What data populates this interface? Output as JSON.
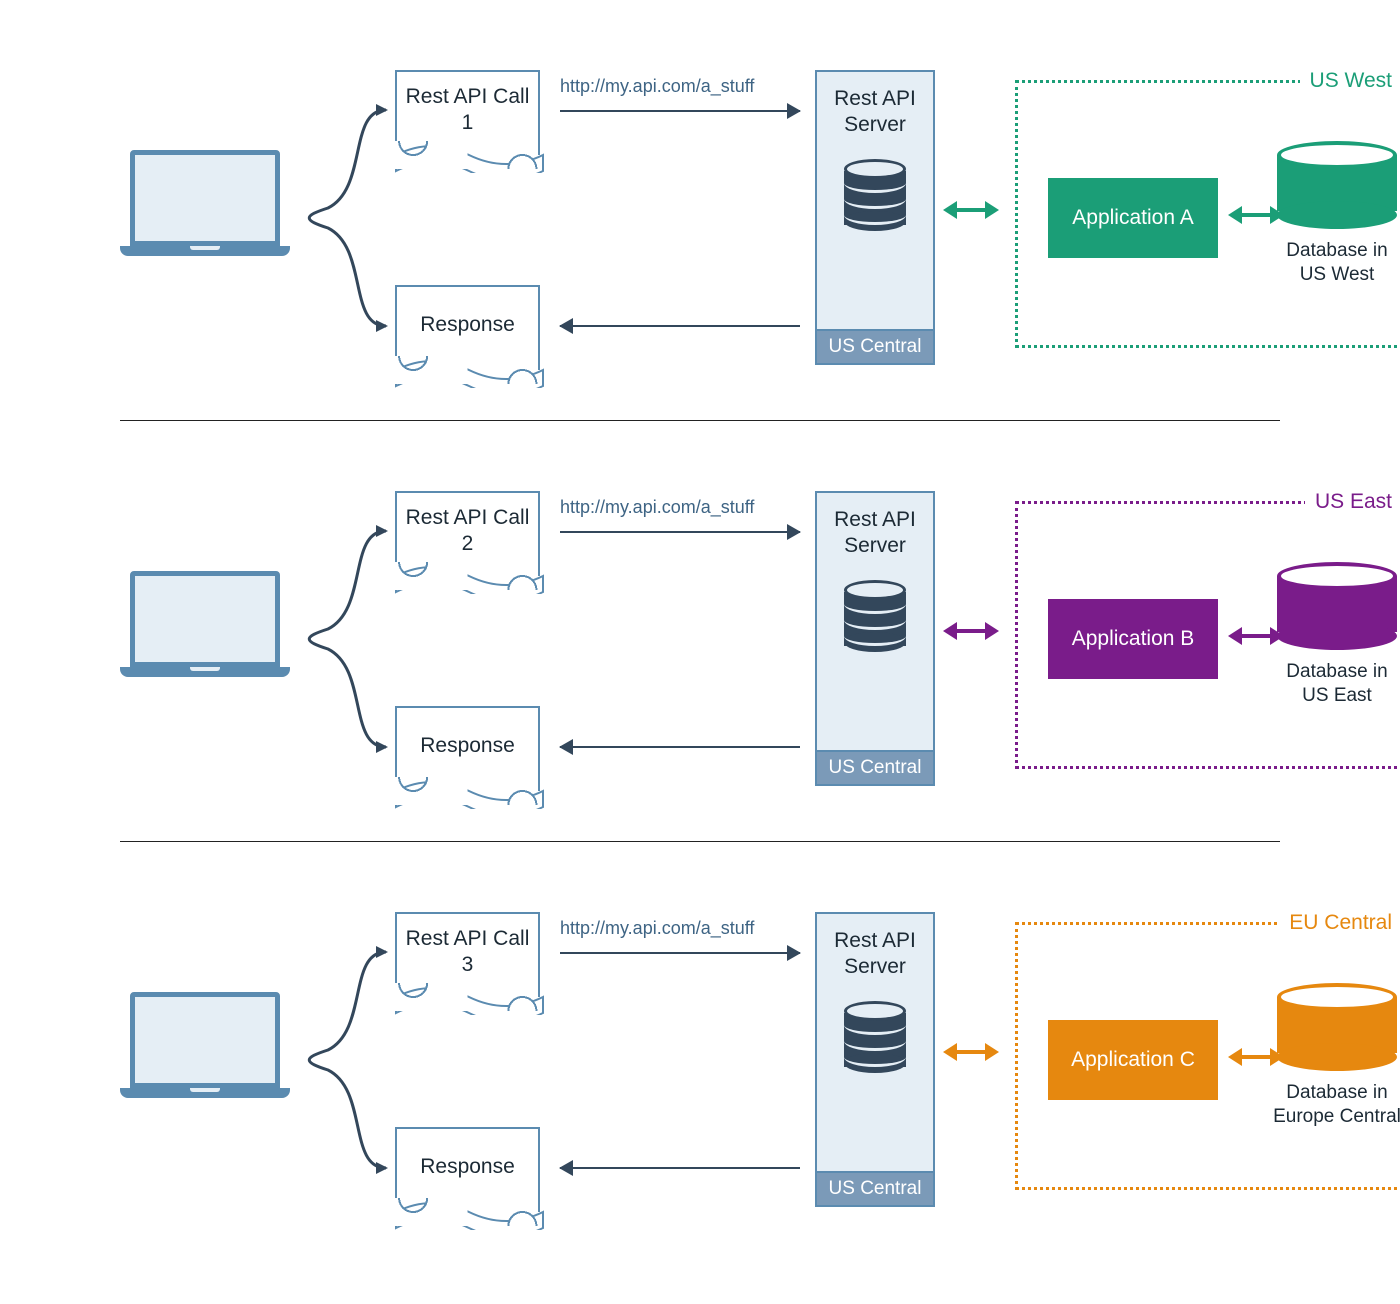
{
  "rows": [
    {
      "call_label": "Rest API Call 1",
      "response_label": "Response",
      "url": "http://my.api.com/a_stuff",
      "server_title": "Rest API Server",
      "server_region": "US Central",
      "region_name": "US West",
      "app_name": "Application A",
      "db_name": "Database in US West",
      "color": "#1b9e77"
    },
    {
      "call_label": "Rest API Call 2",
      "response_label": "Response",
      "url": "http://my.api.com/a_stuff",
      "server_title": "Rest API Server",
      "server_region": "US Central",
      "region_name": "US East",
      "app_name": "Application B",
      "db_name": "Database in US East",
      "color": "#7a1c8a"
    },
    {
      "call_label": "Rest API Call 3",
      "response_label": "Response",
      "url": "http://my.api.com/a_stuff",
      "server_title": "Rest API Server",
      "server_region": "US Central",
      "region_name": "EU Central",
      "app_name": "Application C",
      "db_name": "Database in Europe Central",
      "color": "#e6880f"
    }
  ]
}
